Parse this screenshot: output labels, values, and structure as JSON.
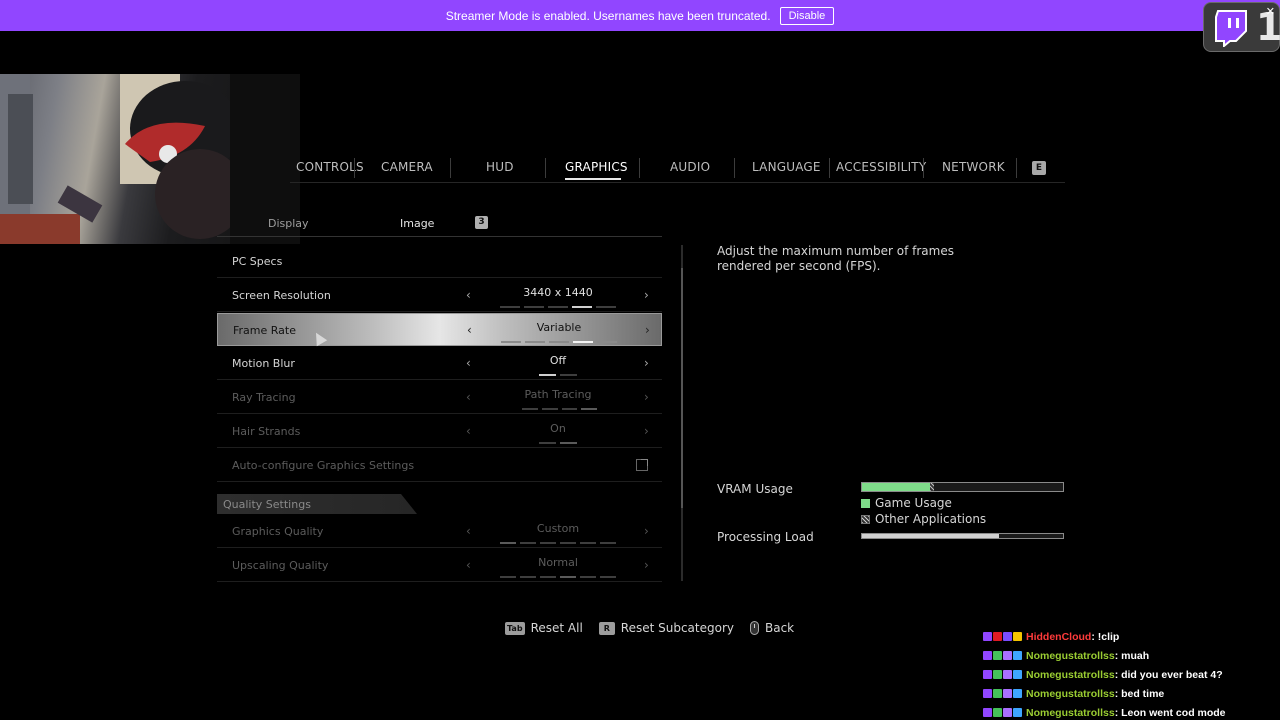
{
  "banner": {
    "text": "Streamer Mode is enabled. Usernames have been truncated.",
    "button": "Disable",
    "color": "#9146ff"
  },
  "twitch_badge": {
    "icon": "twitch-icon",
    "count": "1",
    "close": "✕"
  },
  "tabs": [
    {
      "label": "CONTROLS",
      "active": false
    },
    {
      "label": "CAMERA",
      "active": false
    },
    {
      "label": "HUD",
      "active": false
    },
    {
      "label": "GRAPHICS",
      "active": true
    },
    {
      "label": "AUDIO",
      "active": false
    },
    {
      "label": "LANGUAGE",
      "active": false
    },
    {
      "label": "ACCESSIBILITY",
      "active": false
    },
    {
      "label": "NETWORK",
      "active": false
    }
  ],
  "tab_next_key": "E",
  "subtabs": [
    {
      "label": "Display",
      "active": false
    },
    {
      "label": "Image",
      "active": true
    }
  ],
  "subtab_next_key": "3",
  "settings": [
    {
      "label": "PC Specs",
      "type": "link",
      "disabled": false
    },
    {
      "label": "Screen Resolution",
      "value": "3440 x 1440",
      "pips": 5,
      "active_pip": 4,
      "disabled": false
    },
    {
      "label": "Frame Rate",
      "value": "Variable",
      "pips": 5,
      "active_pip": 4,
      "disabled": false,
      "selected": true
    },
    {
      "label": "Motion Blur",
      "value": "Off",
      "pips": 2,
      "active_pip": 1,
      "disabled": false
    },
    {
      "label": "Ray Tracing",
      "value": "Path Tracing",
      "pips": 4,
      "active_pip": 4,
      "disabled": true
    },
    {
      "label": "Hair Strands",
      "value": "On",
      "pips": 2,
      "active_pip": 2,
      "disabled": true
    },
    {
      "label": "Auto-configure Graphics Settings",
      "type": "external",
      "disabled": true
    }
  ],
  "quality_section": {
    "title": "Quality Settings",
    "items": [
      {
        "label": "Graphics Quality",
        "value": "Custom",
        "pips": 6,
        "active_pip": 1,
        "disabled": true
      },
      {
        "label": "Upscaling Quality",
        "value": "Normal",
        "pips": 6,
        "active_pip": 4,
        "disabled": true
      }
    ]
  },
  "description": "Adjust the maximum number of frames rendered per second (FPS).",
  "vram": {
    "label": "VRAM Usage",
    "game_fraction": 0.34,
    "other_fraction": 0.02,
    "legend_game": "Game Usage",
    "legend_other": "Other Applications",
    "game_color": "#7fdc8a"
  },
  "processing": {
    "label": "Processing Load",
    "fraction": 0.68
  },
  "controls": [
    {
      "key": "Tab",
      "label": "Reset All"
    },
    {
      "key": "R",
      "label": "Reset Subcategory"
    },
    {
      "key": "mouse-icon",
      "label": "Back"
    }
  ],
  "chat": [
    {
      "user": "HiddenCloud",
      "color": "#ff3b3b",
      "msg": ": !clip",
      "badges": [
        "#9146ff",
        "#e01b24",
        "#7a4dff",
        "#f5c400"
      ]
    },
    {
      "user": "Nomegustatrollss",
      "color": "#9acd32",
      "msg": ": muah",
      "badges": [
        "#9146ff",
        "#45c15a",
        "#a970ff",
        "#3ea6ff"
      ]
    },
    {
      "user": "Nomegustatrollss",
      "color": "#9acd32",
      "msg": ": did you ever beat 4?",
      "badges": [
        "#9146ff",
        "#45c15a",
        "#a970ff",
        "#3ea6ff"
      ]
    },
    {
      "user": "Nomegustatrollss",
      "color": "#9acd32",
      "msg": ": bed time",
      "badges": [
        "#9146ff",
        "#45c15a",
        "#a970ff",
        "#3ea6ff"
      ]
    },
    {
      "user": "Nomegustatrollss",
      "color": "#9acd32",
      "msg": ": Leon went cod mode",
      "badges": [
        "#9146ff",
        "#45c15a",
        "#a970ff",
        "#3ea6ff"
      ]
    }
  ]
}
